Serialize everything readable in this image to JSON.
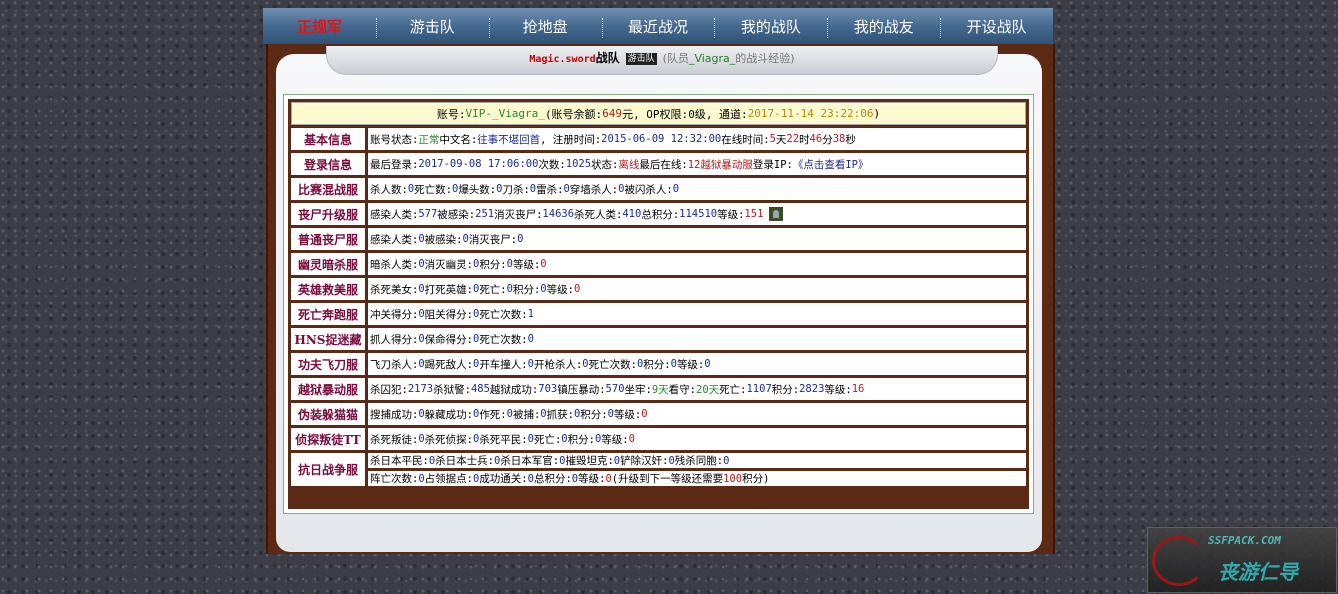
{
  "nav": {
    "items": [
      {
        "label": "正规军",
        "active": true
      },
      {
        "label": "游击队"
      },
      {
        "label": "抢地盘"
      },
      {
        "label": "最近战况"
      },
      {
        "label": "我的战队"
      },
      {
        "label": "我的战友"
      },
      {
        "label": "开设战队"
      }
    ]
  },
  "title": {
    "team": "Magic.sword",
    "team_suffix": "战队",
    "badge": "游击队",
    "desc_prefix": "(队员",
    "member": "_Viagra_",
    "desc_suffix": "的战斗经验)"
  },
  "account": {
    "label": "账号: ",
    "id": "VIP-_Viagra_",
    "balance_label": "(账号余额: ",
    "balance": "649",
    "balance_unit": "元",
    "op_label": ", OP权限: ",
    "op": "0级",
    "channel_label": ", 通道: ",
    "time": "2017-11-14 23:22:06",
    "close": ")"
  },
  "basic": {
    "label": "基本信息",
    "status_label": "账号状态: ",
    "status": "正常",
    "cn_label": " 中文名: ",
    "cn": "往事不堪回首",
    "reg_label": ", 注册时间: ",
    "reg": "2015-06-09 12:32:00",
    "online_label": " 在线时间: ",
    "d": "5",
    "d_u": "天",
    "h": "22",
    "h_u": "时",
    "m": "46",
    "m_u": "分",
    "s": "38",
    "s_u": "秒"
  },
  "login": {
    "label": "登录信息",
    "last_label": "最后登录: ",
    "last": "2017-09-08 17:06:00",
    "count_label": " 次数: ",
    "count": "1025",
    "state_label": " 状态: ",
    "state": "离线",
    "lastsrv_label": " 最后在线: ",
    "lastsrv": "12越狱暴动服",
    "ip_label": " 登录IP: ",
    "ip": "《点击查看IP》"
  },
  "rows": [
    {
      "label": "比赛混战服",
      "parts": [
        [
          "杀人数: ",
          ""
        ],
        [
          "0",
          "n"
        ],
        [
          " 死亡数: ",
          ""
        ],
        [
          "0",
          "n"
        ],
        [
          " 爆头数: ",
          ""
        ],
        [
          "0",
          "n"
        ],
        [
          " 刀杀: ",
          ""
        ],
        [
          "0",
          "n"
        ],
        [
          " 雷杀: ",
          ""
        ],
        [
          "0",
          "n"
        ],
        [
          " 穿墙杀人: ",
          ""
        ],
        [
          "0",
          "n"
        ],
        [
          " 被闪杀人: ",
          ""
        ],
        [
          "0",
          "n"
        ]
      ]
    },
    {
      "label": "丧尸升级服",
      "parts": [
        [
          "感染人类: ",
          ""
        ],
        [
          "577",
          "n"
        ],
        [
          " 被感染: ",
          ""
        ],
        [
          "251",
          "n"
        ],
        [
          " 消灭丧尸: ",
          ""
        ],
        [
          "14636",
          "n"
        ],
        [
          " 杀死人类: ",
          ""
        ],
        [
          "410",
          "n"
        ],
        [
          " 总积分: ",
          ""
        ],
        [
          "114510",
          "n"
        ],
        [
          " 等级: ",
          ""
        ],
        [
          "151",
          "r"
        ]
      ],
      "avatar": true
    },
    {
      "label": "普通丧尸服",
      "parts": [
        [
          "感染人类: ",
          ""
        ],
        [
          "0",
          "n"
        ],
        [
          " 被感染: ",
          ""
        ],
        [
          "0",
          "n"
        ],
        [
          " 消灭丧尸: ",
          ""
        ],
        [
          "0",
          "n"
        ]
      ]
    },
    {
      "label": "幽灵暗杀服",
      "parts": [
        [
          "暗杀人类: ",
          ""
        ],
        [
          "0",
          "n"
        ],
        [
          " 消灭幽灵: ",
          ""
        ],
        [
          "0",
          "n"
        ],
        [
          " 积分: ",
          ""
        ],
        [
          "0",
          "n"
        ],
        [
          " 等级: ",
          ""
        ],
        [
          "0",
          "r"
        ]
      ]
    },
    {
      "label": "英雄救美服",
      "parts": [
        [
          "杀死美女: ",
          ""
        ],
        [
          "0",
          "n"
        ],
        [
          " 打死英雄: ",
          ""
        ],
        [
          "0",
          "n"
        ],
        [
          " 死亡: ",
          ""
        ],
        [
          "0",
          "n"
        ],
        [
          " 积分: ",
          ""
        ],
        [
          "0",
          "n"
        ],
        [
          " 等级: ",
          ""
        ],
        [
          "0",
          "r"
        ]
      ]
    },
    {
      "label": "死亡奔跑服",
      "parts": [
        [
          "冲关得分: ",
          ""
        ],
        [
          "0",
          "n"
        ],
        [
          " 阻关得分: ",
          ""
        ],
        [
          "0",
          "n"
        ],
        [
          " 死亡次数: ",
          ""
        ],
        [
          "1",
          "n"
        ]
      ]
    },
    {
      "label": "HNS捉迷藏",
      "parts": [
        [
          "抓人得分: ",
          ""
        ],
        [
          "0",
          "n"
        ],
        [
          " 保命得分: ",
          ""
        ],
        [
          "0",
          "n"
        ],
        [
          " 死亡次数: ",
          ""
        ],
        [
          "0",
          "n"
        ]
      ]
    },
    {
      "label": "功夫飞刀服",
      "parts": [
        [
          "飞刀杀人: ",
          ""
        ],
        [
          "0",
          "n"
        ],
        [
          " 踢死敌人: ",
          ""
        ],
        [
          "0",
          "n"
        ],
        [
          " 开车撞人: ",
          ""
        ],
        [
          "0",
          "n"
        ],
        [
          " 开枪杀人: ",
          ""
        ],
        [
          "0",
          "n"
        ],
        [
          " 死亡次数: ",
          ""
        ],
        [
          "0",
          "n"
        ],
        [
          " 积分: ",
          ""
        ],
        [
          "0",
          "n"
        ],
        [
          " 等级: ",
          ""
        ],
        [
          "0",
          "n"
        ]
      ]
    },
    {
      "label": "越狱暴动服",
      "parts": [
        [
          "杀囚犯: ",
          ""
        ],
        [
          "2173",
          "n"
        ],
        [
          " 杀狱警: ",
          ""
        ],
        [
          "485",
          "n"
        ],
        [
          " 越狱成功: ",
          ""
        ],
        [
          "703",
          "n"
        ],
        [
          " 镇压暴动: ",
          ""
        ],
        [
          "570",
          "n"
        ],
        [
          " 坐牢: ",
          ""
        ],
        [
          "9天",
          "g"
        ],
        [
          " 看守: ",
          ""
        ],
        [
          "20天",
          "g"
        ],
        [
          " 死亡: ",
          ""
        ],
        [
          "1107",
          "n"
        ],
        [
          " 积分: ",
          ""
        ],
        [
          "2823",
          "n"
        ],
        [
          " 等级: ",
          ""
        ],
        [
          "16",
          "r"
        ]
      ]
    },
    {
      "label": "伪装躲猫猫",
      "parts": [
        [
          "搜捕成功: ",
          ""
        ],
        [
          "0",
          "n"
        ],
        [
          " 躲藏成功: ",
          ""
        ],
        [
          "0",
          "n"
        ],
        [
          " 作死: ",
          ""
        ],
        [
          "0",
          "n"
        ],
        [
          " 被捕: ",
          ""
        ],
        [
          "0",
          "n"
        ],
        [
          " 抓获: ",
          ""
        ],
        [
          "0",
          "n"
        ],
        [
          " 积分: ",
          ""
        ],
        [
          "0",
          "n"
        ],
        [
          " 等级: ",
          ""
        ],
        [
          "0",
          "r"
        ]
      ]
    },
    {
      "label": "侦探叛徒TT",
      "parts": [
        [
          "杀死叛徒: ",
          ""
        ],
        [
          "0",
          "n"
        ],
        [
          " 杀死侦探: ",
          ""
        ],
        [
          "0",
          "n"
        ],
        [
          " 杀死平民: ",
          ""
        ],
        [
          "0",
          "n"
        ],
        [
          " 死亡: ",
          ""
        ],
        [
          "0",
          "n"
        ],
        [
          " 积分: ",
          ""
        ],
        [
          "0",
          "n"
        ],
        [
          " 等级: ",
          ""
        ],
        [
          "0",
          "r"
        ]
      ]
    }
  ],
  "war": {
    "label": "抗日战争服",
    "line1": [
      [
        "杀日本平民: ",
        ""
      ],
      [
        "0",
        "n"
      ],
      [
        " 杀日本士兵: ",
        ""
      ],
      [
        "0",
        "n"
      ],
      [
        " 杀日本军官: ",
        ""
      ],
      [
        "0",
        "n"
      ],
      [
        " 摧毁坦克: ",
        ""
      ],
      [
        "0",
        "n"
      ],
      [
        " 铲除汉奸: ",
        ""
      ],
      [
        "0",
        "n"
      ],
      [
        " 残杀同胞: ",
        ""
      ],
      [
        "0",
        "n"
      ]
    ],
    "line2": [
      [
        "阵亡次数: ",
        ""
      ],
      [
        "0",
        "n"
      ],
      [
        " 占领据点: ",
        ""
      ],
      [
        "0",
        "n"
      ],
      [
        " 成功通关: ",
        ""
      ],
      [
        "0",
        "n"
      ],
      [
        " 总积分: ",
        ""
      ],
      [
        "0",
        "n"
      ],
      [
        " 等级: ",
        ""
      ],
      [
        "0",
        "r"
      ],
      [
        " (升级到下一等级还需要",
        ""
      ],
      [
        "100",
        "r"
      ],
      [
        "积分)",
        ""
      ]
    ]
  },
  "watermark": {
    "line1": "SSFPACK.COM",
    "line2": "丧游仁导"
  }
}
